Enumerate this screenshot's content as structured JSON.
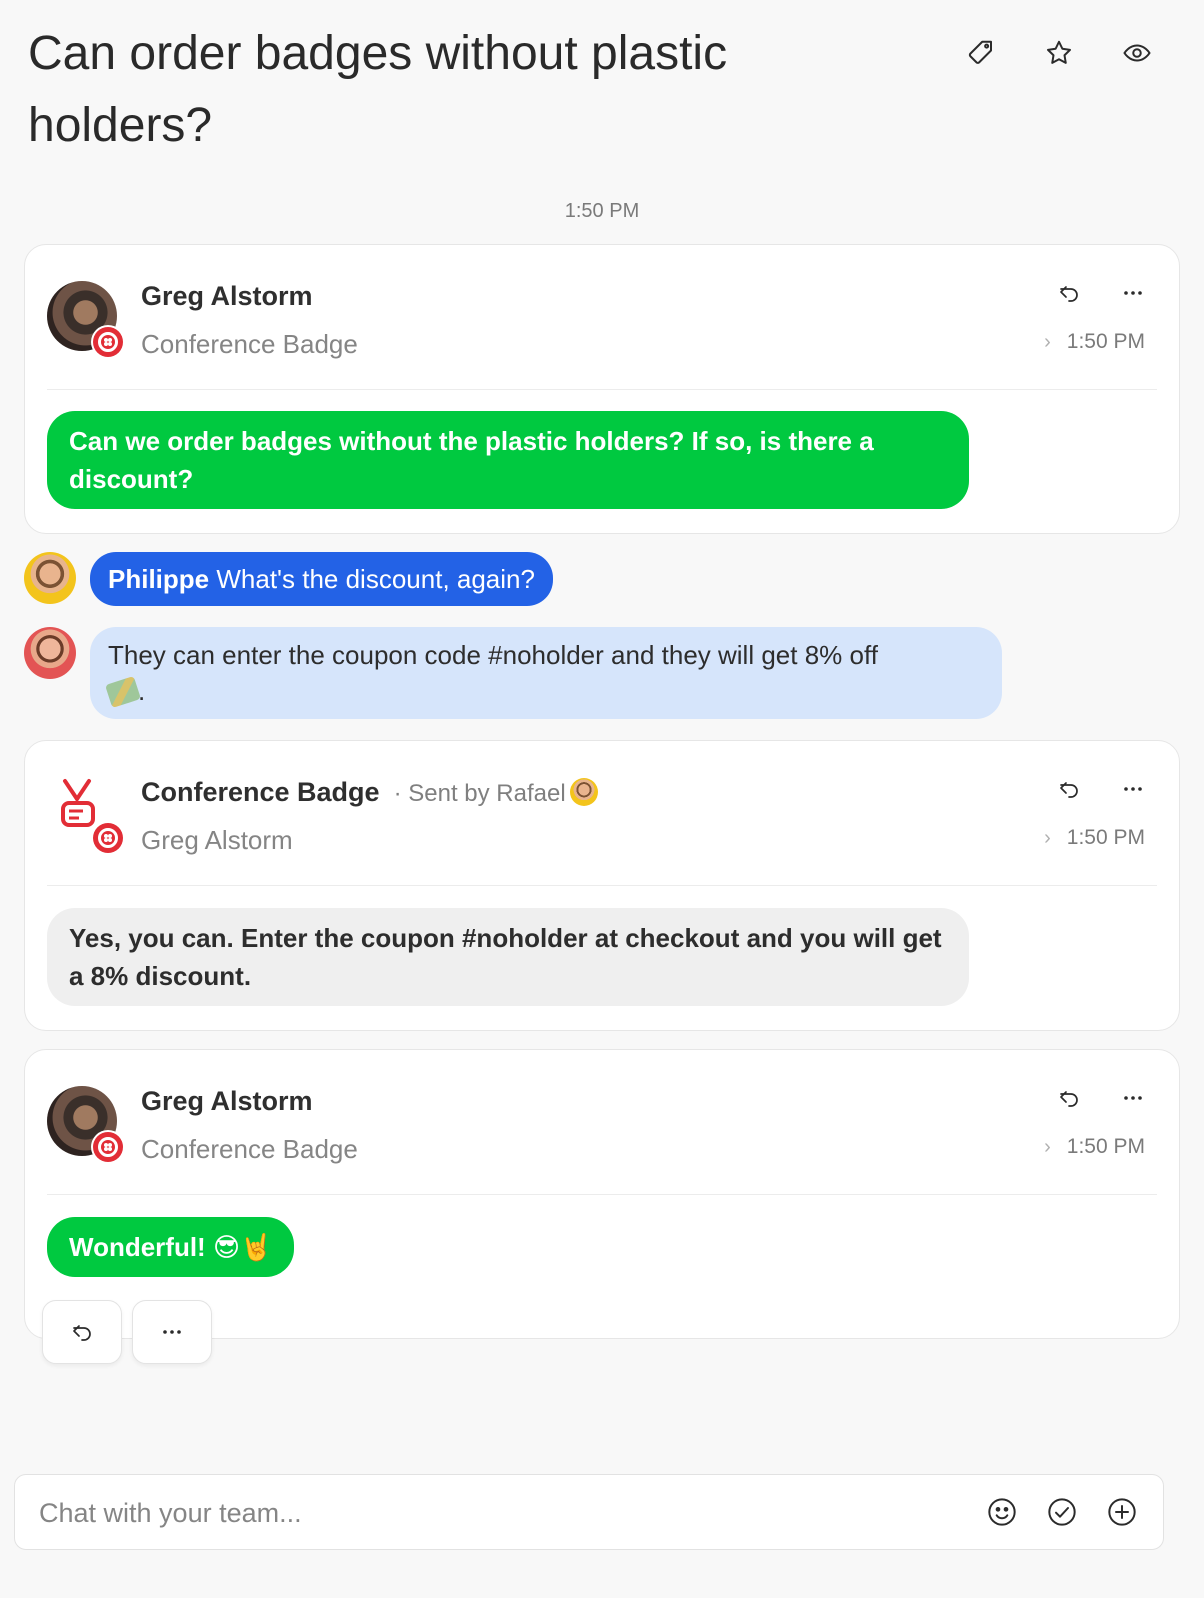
{
  "header": {
    "title": "Can order badges without plastic holders?",
    "icons": [
      "tag-icon",
      "star-icon",
      "eye-icon"
    ]
  },
  "thread_time": "1:50 PM",
  "messages": [
    {
      "sender": "Greg Alstorm",
      "subtitle": "Conference Badge",
      "time": "1:50 PM",
      "body": "Can we order badges without the plastic holders? If so, is there a discount?"
    },
    {
      "sender": "Conference Badge",
      "sent_by": "Sent by Rafael",
      "subtitle": "Greg Alstorm",
      "time": "1:50 PM",
      "body": "Yes, you can. Enter the coupon #noholder at checkout and you will get a 8% discount."
    },
    {
      "sender": "Greg Alstorm",
      "subtitle": "Conference Badge",
      "time": "1:50 PM",
      "body": "Wonderful! 😎🤘"
    }
  ],
  "comments": [
    {
      "author": "Philippe",
      "text": "What's the discount, again?"
    },
    {
      "text": "They can enter the coupon code #noholder and they will get 8% off",
      "suffix": "."
    }
  ],
  "composer": {
    "placeholder": "Chat with your team...",
    "icons": [
      "emoji-icon",
      "check-circle-icon",
      "plus-circle-icon"
    ]
  },
  "colors": {
    "green_bubble": "#00c940",
    "blue_pill": "#2362e6",
    "light_blue_bubble": "#d6e5fb",
    "twilio_red": "#e22d36"
  }
}
